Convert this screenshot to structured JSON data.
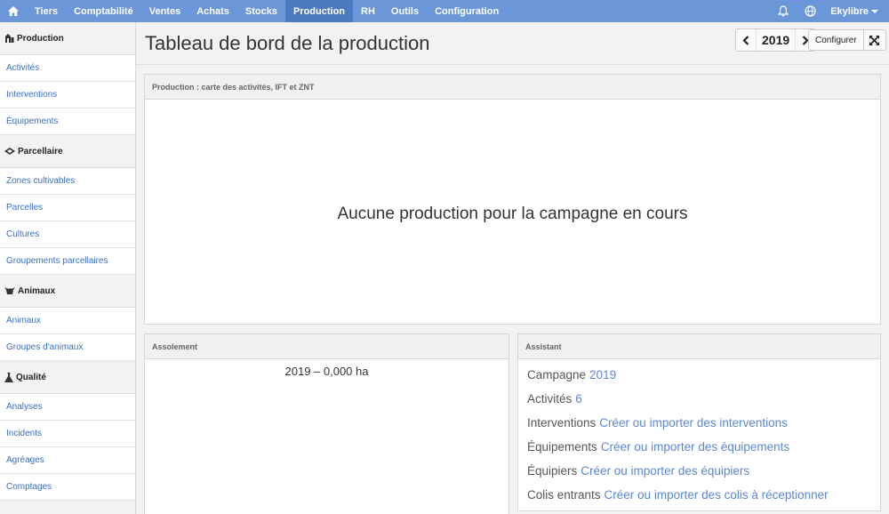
{
  "topnav": {
    "home_icon": "home-icon",
    "items": [
      "Tiers",
      "Comptabilité",
      "Ventes",
      "Achats",
      "Stocks",
      "Production",
      "RH",
      "Outils",
      "Configuration"
    ],
    "active": "Production",
    "user": "Ekylibre",
    "icons": [
      "bell-icon",
      "globe-icon"
    ]
  },
  "sidebar": {
    "sections": [
      {
        "title": "Production",
        "icon": "production-icon",
        "links": [
          "Activités",
          "Interventions",
          "Équipements"
        ]
      },
      {
        "title": "Parcellaire",
        "icon": "parcel-icon",
        "links": [
          "Zones cultivables",
          "Parcelles",
          "Cultures",
          "Groupements parcellaires"
        ]
      },
      {
        "title": "Animaux",
        "icon": "cow-icon",
        "links": [
          "Animaux",
          "Groupes d'animaux"
        ]
      },
      {
        "title": "Qualité",
        "icon": "flask-icon",
        "links": [
          "Analyses",
          "Incidents",
          "Agréages",
          "Comptages"
        ]
      }
    ]
  },
  "header": {
    "title": "Tableau de bord de la production",
    "year": "2019",
    "configure": "Configurer"
  },
  "panels": {
    "map": {
      "title": "Production : carte des activités, IFT et ZNT",
      "empty_message": "Aucune production pour la campagne en cours"
    },
    "assolement": {
      "title": "Assolement",
      "value": "2019 – 0,000 ha"
    },
    "assistant": {
      "title": "Assistant",
      "rows": [
        {
          "label": "Campagne",
          "link": "2019"
        },
        {
          "label": "Activités",
          "link": "6"
        },
        {
          "label": "Interventions",
          "link": "Créer ou importer des interventions"
        },
        {
          "label": "Équipements",
          "link": "Créer ou importer des équipements"
        },
        {
          "label": "Équipiers",
          "link": "Créer ou importer des équipiers"
        },
        {
          "label": "Colis entrants",
          "link": "Créer ou importer des colis à réceptionner"
        }
      ]
    }
  },
  "colors": {
    "nav": "#6b97d8",
    "nav_active": "#4c79bf",
    "link": "#3b6fc2",
    "assistant_link": "#5a87d1"
  }
}
